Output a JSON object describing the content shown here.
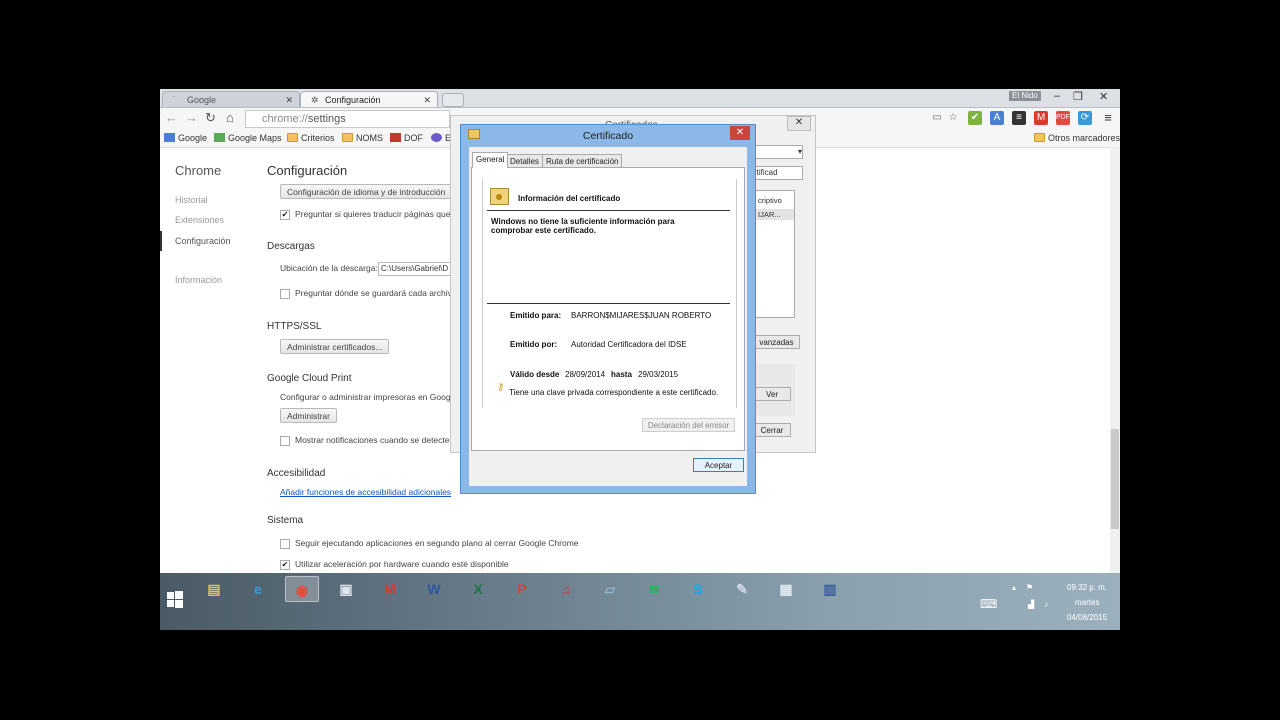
{
  "browser": {
    "tabs": [
      {
        "label": "Google"
      },
      {
        "label": "Configuración"
      }
    ],
    "user_label": "El Nido",
    "window_controls": {
      "minimize": "‒",
      "maximize": "❐",
      "close": "✕"
    },
    "url": {
      "scheme": "chrome://",
      "path": "settings"
    },
    "bookmarks": [
      {
        "label": "Google",
        "icon": "google-icon"
      },
      {
        "label": "Google Maps",
        "icon": "maps-icon"
      },
      {
        "label": "Criterios",
        "icon": "folder-icon"
      },
      {
        "label": "NOMS",
        "icon": "folder-icon"
      },
      {
        "label": "DOF",
        "icon": "dof-icon"
      },
      {
        "label": "E",
        "icon": "globe-icon"
      }
    ],
    "other_bookmarks": "Otros marcadores"
  },
  "settings": {
    "sidebar": {
      "title": "Chrome",
      "items": [
        "Historial",
        "Extensiones",
        "Configuración",
        "Información"
      ]
    },
    "page_title": "Configuración",
    "language_button": "Configuración de idioma y de introducción",
    "translate_option": "Preguntar si quieres traducir páginas que",
    "downloads": {
      "heading": "Descargas",
      "location_label": "Ubicación de la descarga:",
      "location_value": "C:\\Users\\Gabriel\\D",
      "ask_option": "Preguntar dónde se guardará cada archiv"
    },
    "https": {
      "heading": "HTTPS/SSL",
      "button": "Administrar certificados..."
    },
    "cloud_print": {
      "heading": "Google Cloud Print",
      "text": "Configurar o administrar impresoras en Goog",
      "button": "Administrar",
      "notify_option": "Mostrar notificaciones cuando se detecte"
    },
    "accessibility": {
      "heading": "Accesibilidad",
      "link": "Añadir funciones de accesibilidad adicionales"
    },
    "system": {
      "heading": "Sistema",
      "background_option": "Seguir ejecutando aplicaciones en segundo plano al cerrar Google Chrome",
      "hardware_option": "Utilizar aceleración por hardware cuando esté disponible"
    }
  },
  "certificates_dialog": {
    "title": "Certificados",
    "close": "✕",
    "col_fragment": "criptivo",
    "row_fragment": "IJAR...",
    "tab_fragment": "rtificad",
    "advanced_button": "vanzadas",
    "view_button": "Ver",
    "close_button": "Cerrar"
  },
  "certificate_dialog": {
    "title": "Certificado",
    "close": "✕",
    "tabs": [
      "General",
      "Detalles",
      "Ruta de certificación"
    ],
    "info_heading": "Información del certificado",
    "warning_line1": "Windows no tiene la suficiente información para",
    "warning_line2": "comprobar este certificado.",
    "issued_to_label": "Emitido para:",
    "issued_to_value": "BARRON$MIJARES$JUAN ROBERTO",
    "issued_by_label": "Emitido por:",
    "issued_by_value": "Autoridad Certificadora del IDSE",
    "valid_from_label": "Válido desde",
    "valid_from_value": "28/09/2014",
    "valid_to_label": "hasta",
    "valid_to_value": "29/03/2015",
    "private_key_text": "Tiene una clave privada correspondiente a este certificado.",
    "issuer_statement_button": "Declaración del emisor",
    "ok_button": "Aceptar"
  },
  "taskbar": {
    "apps": [
      {
        "name": "file-explorer-icon",
        "glyph": "▤",
        "color": "#e8c15a"
      },
      {
        "name": "internet-explorer-icon",
        "glyph": "e",
        "color": "#3a9ad9"
      },
      {
        "name": "chrome-icon",
        "glyph": "◉",
        "color": "#e44d3a"
      },
      {
        "name": "app-window-icon",
        "glyph": "▣",
        "color": "#dfe6ee"
      },
      {
        "name": "gmail-icon",
        "glyph": "M",
        "color": "#d93a2c"
      },
      {
        "name": "word-icon",
        "glyph": "W",
        "color": "#2b579a"
      },
      {
        "name": "excel-icon",
        "glyph": "X",
        "color": "#217346"
      },
      {
        "name": "powerpoint-icon",
        "glyph": "P",
        "color": "#d24726"
      },
      {
        "name": "itunes-icon",
        "glyph": "♫",
        "color": "#e0304b"
      },
      {
        "name": "notes-icon",
        "glyph": "▱",
        "color": "#8fb3c8"
      },
      {
        "name": "spotify-icon",
        "glyph": "≋",
        "color": "#1db954"
      },
      {
        "name": "skype-icon",
        "glyph": "S",
        "color": "#00aff0"
      },
      {
        "name": "paint-icon",
        "glyph": "✎",
        "color": "#cfd9e3"
      },
      {
        "name": "calculator-icon",
        "glyph": "▦",
        "color": "#dfe6ee"
      },
      {
        "name": "save-disk-icon",
        "glyph": "▥",
        "color": "#3c5f9e"
      }
    ],
    "clock_time": "09:32 p. m.",
    "clock_day": "martes",
    "clock_date": "04/08/2015"
  }
}
